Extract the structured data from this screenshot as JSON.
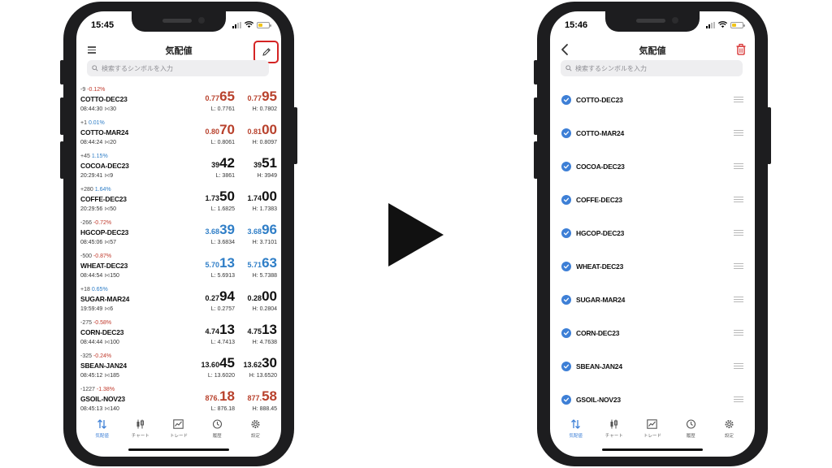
{
  "left_screen": {
    "status_time": "15:45",
    "title": "気配値",
    "search_placeholder": "検索するシンボルを入力",
    "quotes": [
      {
        "change": "-9",
        "pct": "-0.12%",
        "dir": "down",
        "symbol": "COTTO-DEC23",
        "time": "08:44:30",
        "vol": "30",
        "bid_small": "0.77",
        "bid_big": "65",
        "ask_small": "0.77",
        "ask_big": "95",
        "color": "red",
        "low": "L: 0.7761",
        "high": "H: 0.7802"
      },
      {
        "change": "+1",
        "pct": "0.01%",
        "dir": "up",
        "symbol": "COTTO-MAR24",
        "time": "08:44:24",
        "vol": "20",
        "bid_small": "0.80",
        "bid_big": "70",
        "ask_small": "0.81",
        "ask_big": "00",
        "color": "red",
        "low": "L: 0.8061",
        "high": "H: 0.8097"
      },
      {
        "change": "+45",
        "pct": "1.15%",
        "dir": "up",
        "symbol": "COCOA-DEC23",
        "time": "20:29:41",
        "vol": "9",
        "bid_small": "39",
        "bid_big": "42",
        "ask_small": "39",
        "ask_big": "51",
        "color": "black",
        "low": "L: 3861",
        "high": "H: 3949"
      },
      {
        "change": "+280",
        "pct": "1.64%",
        "dir": "up",
        "symbol": "COFFE-DEC23",
        "time": "20:29:56",
        "vol": "50",
        "bid_small": "1.73",
        "bid_big": "50",
        "ask_small": "1.74",
        "ask_big": "00",
        "color": "black",
        "low": "L: 1.6825",
        "high": "H: 1.7383"
      },
      {
        "change": "-266",
        "pct": "-0.72%",
        "dir": "down",
        "symbol": "HGCOP-DEC23",
        "time": "08:45:06",
        "vol": "57",
        "bid_small": "3.68",
        "bid_big": "39",
        "ask_small": "3.68",
        "ask_big": "96",
        "color": "blue",
        "low": "L: 3.6834",
        "high": "H: 3.7101"
      },
      {
        "change": "-500",
        "pct": "-0.87%",
        "dir": "down",
        "symbol": "WHEAT-DEC23",
        "time": "08:44:54",
        "vol": "150",
        "bid_small": "5.70",
        "bid_big": "13",
        "ask_small": "5.71",
        "ask_big": "63",
        "color": "blue",
        "low": "L: 5.6913",
        "high": "H: 5.7388"
      },
      {
        "change": "+18",
        "pct": "0.65%",
        "dir": "up",
        "symbol": "SUGAR-MAR24",
        "time": "19:59:49",
        "vol": "6",
        "bid_small": "0.27",
        "bid_big": "94",
        "ask_small": "0.28",
        "ask_big": "00",
        "color": "black",
        "low": "L: 0.2757",
        "high": "H: 0.2804"
      },
      {
        "change": "-275",
        "pct": "-0.58%",
        "dir": "down",
        "symbol": "CORN-DEC23",
        "time": "08:44:44",
        "vol": "100",
        "bid_small": "4.74",
        "bid_big": "13",
        "ask_small": "4.75",
        "ask_big": "13",
        "color": "black",
        "low": "L: 4.7413",
        "high": "H: 4.7638"
      },
      {
        "change": "-325",
        "pct": "-0.24%",
        "dir": "down",
        "symbol": "SBEAN-JAN24",
        "time": "08:45:12",
        "vol": "185",
        "bid_small": "13.60",
        "bid_big": "45",
        "ask_small": "13.62",
        "ask_big": "30",
        "color": "black",
        "low": "L: 13.6020",
        "high": "H: 13.6520"
      },
      {
        "change": "-1227",
        "pct": "-1.38%",
        "dir": "down",
        "symbol": "GSOIL-NOV23",
        "time": "08:45:13",
        "vol": "140",
        "bid_small": "876.",
        "bid_big": "18",
        "ask_small": "877.",
        "ask_big": "58",
        "color": "red",
        "low": "L: 876.18",
        "high": "H: 888.45"
      }
    ]
  },
  "right_screen": {
    "status_time": "15:46",
    "title": "気配値",
    "search_placeholder": "検索するシンボルを入力",
    "items": [
      "COTTO-DEC23",
      "COTTO-MAR24",
      "COCOA-DEC23",
      "COFFE-DEC23",
      "HGCOP-DEC23",
      "WHEAT-DEC23",
      "SUGAR-MAR24",
      "CORN-DEC23",
      "SBEAN-JAN24",
      "GSOIL-NOV23"
    ]
  },
  "tabs": [
    {
      "label": "気配値",
      "icon": "quotes-arrows-icon",
      "active": true
    },
    {
      "label": "チャート",
      "icon": "candlestick-icon",
      "active": false
    },
    {
      "label": "トレード",
      "icon": "trade-chart-icon",
      "active": false
    },
    {
      "label": "履歴",
      "icon": "history-clock-icon",
      "active": false
    },
    {
      "label": "設定",
      "icon": "gear-icon",
      "active": false
    }
  ],
  "colors": {
    "accent": "#3d7fd6",
    "price_red": "#b8412c",
    "price_blue": "#2f7ec7",
    "highlight_border": "#d42424"
  }
}
